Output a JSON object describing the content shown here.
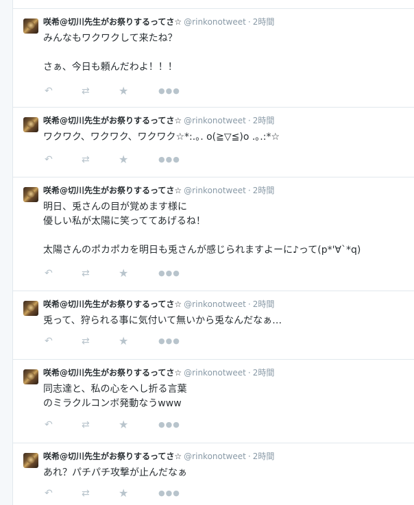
{
  "tweets": [
    {
      "name": "咲希@切川先生がお祭りするってさ☆",
      "handle": "@rinkonotweet",
      "separator": "·",
      "time": "2時間",
      "text": "みんなもワクワクして来たね？\n\nさぁ、今日も頼んだわよ！！！"
    },
    {
      "name": "咲希@切川先生がお祭りするってさ☆",
      "handle": "@rinkonotweet",
      "separator": "·",
      "time": "2時間",
      "text": "ワクワク、ワクワク、ワクワク☆*:.｡. o(≧▽≦)o .｡.:*☆"
    },
    {
      "name": "咲希@切川先生がお祭りするってさ☆",
      "handle": "@rinkonotweet",
      "separator": "·",
      "time": "2時間",
      "text": "明日、兎さんの目が覚めます様に\n優しい私が太陽に笑っててあげるね！\n\n太陽さんのポカポカを明日も兎さんが感じられますよーに♪って(p*'∀`*q)"
    },
    {
      "name": "咲希@切川先生がお祭りするってさ☆",
      "handle": "@rinkonotweet",
      "separator": "·",
      "time": "2時間",
      "text": "兎って、狩られる事に気付いて無いから兎なんだなぁ…"
    },
    {
      "name": "咲希@切川先生がお祭りするってさ☆",
      "handle": "@rinkonotweet",
      "separator": "·",
      "time": "2時間",
      "text": "同志達と、私の心をへし折る言葉\nのミラクルコンボ発動なうwww"
    },
    {
      "name": "咲希@切川先生がお祭りするってさ☆",
      "handle": "@rinkonotweet",
      "separator": "·",
      "time": "2時間",
      "text": "あれ？パチパチ攻撃が止んだなぁ"
    }
  ],
  "icons": {
    "reply": "reply-icon",
    "retweet": "retweet-icon",
    "favorite": "star-icon",
    "more": "more-icon"
  },
  "colors": {
    "name": "#292f33",
    "meta": "#8899a6",
    "action": "#b8c4cc",
    "border": "#e1e8ed"
  }
}
